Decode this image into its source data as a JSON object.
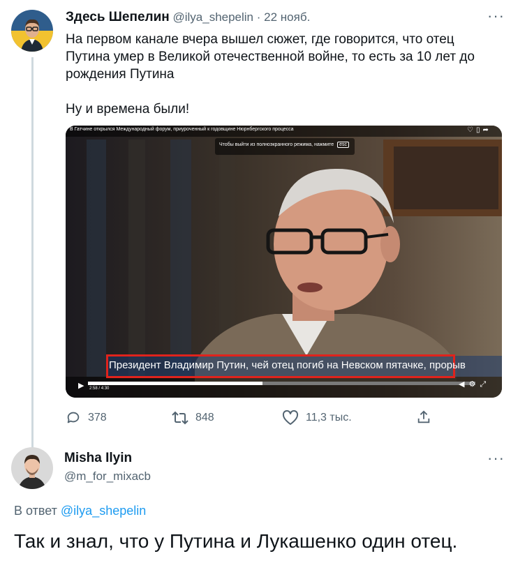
{
  "tweet": {
    "author_name": "Здесь Шепелин",
    "handle": "@ilya_shepelin",
    "separator": "·",
    "date": "22 нояб.",
    "text": "На первом канале вчера вышел сюжет, где говорится, что отец Путина умер в Великой отечественной войне, то есть за 10 лет до рождения Путина\n\nНу и времена были!",
    "video": {
      "top_caption": "В Гатчине открылся Международный форум, приуроченный к годовщине Нюрнбергского процесса",
      "fullscreen_hint": "Чтобы выйти из полноэкранного режима, нажмите",
      "esc_key": "esc",
      "subtitle": "Президент Владимир Путин, чей отец погиб на Невском пятачке, прорыв",
      "time_current": "2:58",
      "time_total": "4:30",
      "progress": 0.45,
      "highlight_color": "#e0231c"
    },
    "actions": {
      "replies": "378",
      "retweets": "848",
      "likes": "11,3 тыс."
    }
  },
  "reply": {
    "author_name": "Misha Ilyin",
    "handle": "@m_for_mixacb",
    "in_reply_prefix": "В ответ",
    "in_reply_handle": "@ilya_shepelin",
    "text": "Так и знал, что у Путина и Лукашенко один отец."
  },
  "colors": {
    "accent": "#1d9bf0",
    "muted": "#536471"
  },
  "icons": [
    "more-icon",
    "reply-icon",
    "retweet-icon",
    "like-icon",
    "share-icon",
    "play-icon",
    "volume-icon",
    "settings-icon",
    "fullscreen-icon",
    "heart-outline-icon",
    "bookmark-icon",
    "share-arrow-icon"
  ]
}
